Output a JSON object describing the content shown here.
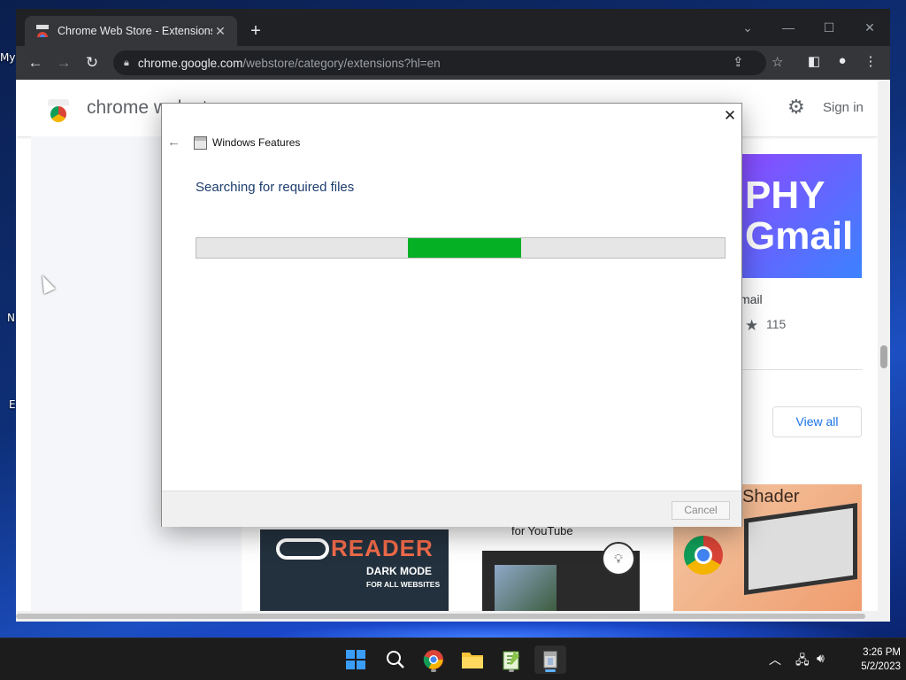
{
  "browser": {
    "tab_title": "Chrome Web Store - Extensions",
    "url_host": "chrome.google.com",
    "url_path": "/webstore/category/extensions?hl=en"
  },
  "store": {
    "title": "chrome web store",
    "signin": "Sign in",
    "banner_line1": "PHY",
    "banner_line2": "Gmail",
    "banner_name": "mail",
    "rating_count": "115",
    "view_all": "View all",
    "card1_title": "READER",
    "card1_line1": "DARK MODE",
    "card1_line2": "FOR ALL WEBSITES",
    "card2_text": "for YouTube",
    "card3_title": "Shader"
  },
  "dialog": {
    "app_title": "Windows Features",
    "heading": "Searching for required files",
    "cancel": "Cancel",
    "progress_start": 0.4,
    "progress_end": 0.615
  },
  "desktop": {
    "icon1": "My",
    "icon2": "N",
    "icon3": "E"
  },
  "taskbar": {
    "time": "3:26 PM",
    "date": "5/2/2023"
  },
  "colors": {
    "progress_green": "#06b025",
    "accent_blue": "#1a73e8"
  }
}
